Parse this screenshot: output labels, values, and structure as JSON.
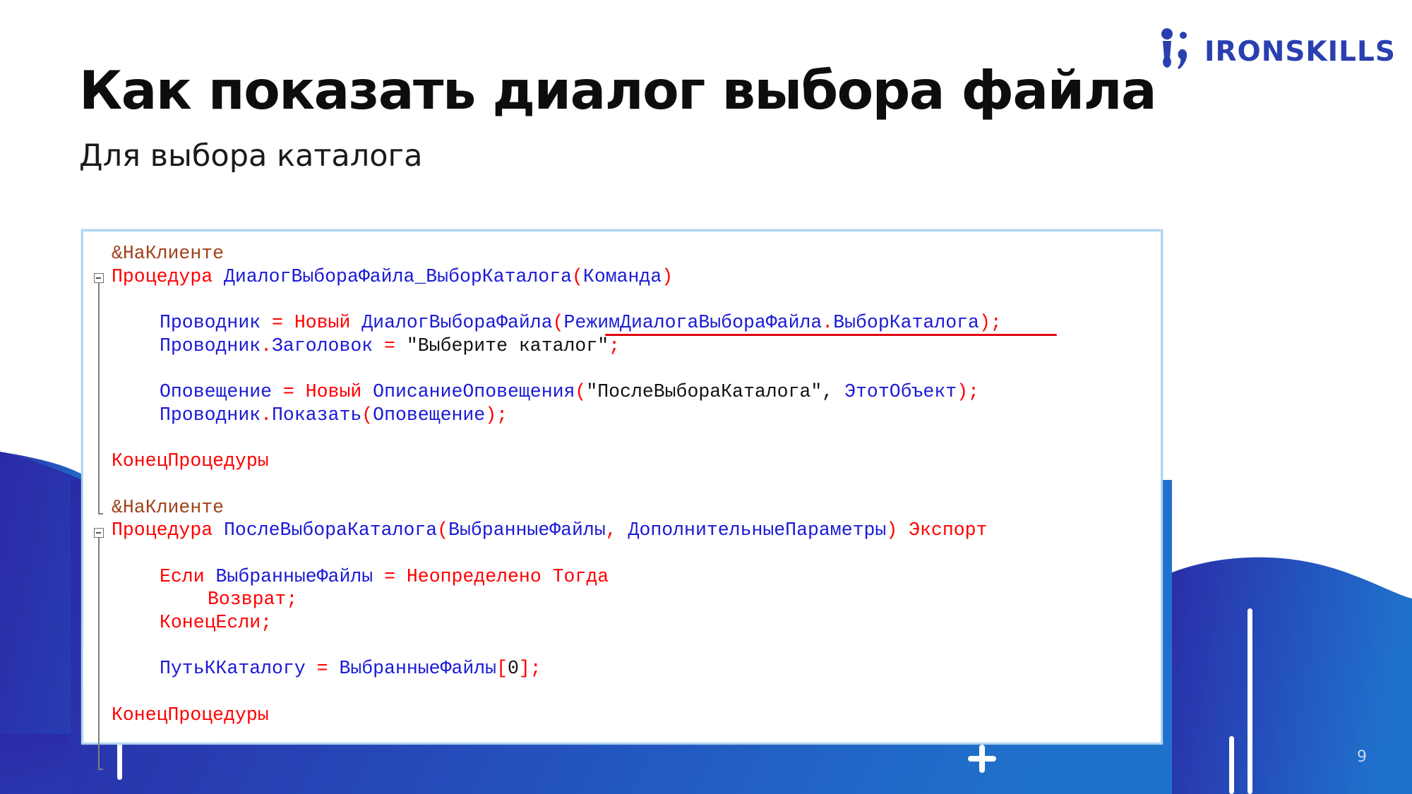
{
  "brand": {
    "name": "IRONSKILLS",
    "logo_icon": "ironskills-logo-icon",
    "color": "#2a3fb0"
  },
  "slide": {
    "title": "Как показать диалог выбора файла",
    "subtitle": "Для выбора каталога",
    "page_number": "9"
  },
  "colors": {
    "wave_gradient": [
      "#2b2aa6",
      "#1f6fc9"
    ],
    "keyword": "#ff0000",
    "identifier": "#1a1ad6",
    "directive": "#a0421a",
    "highlight_underline": "#e00010"
  },
  "code": {
    "language": "1C:Enterprise",
    "p1": {
      "directive": "&НаКлиенте",
      "kw_procedure": "Процедура",
      "name": "ДиалогВыбораФайла_ВыборКаталога",
      "lpar": "(",
      "param": "Команда",
      "rpar": ")",
      "l3_var": "Проводник",
      "l3_eq": " = ",
      "l3_new": "Новый",
      "l3_type": "ДиалогВыбораФайла",
      "l3_lpar": "(",
      "l3_mode_enum": "РежимДиалогаВыбораФайла",
      "l3_dot": ".",
      "l3_mode_value": "ВыборКаталога",
      "l3_end": ");",
      "l4_var": "Проводник",
      "l4_dot": ".",
      "l4_prop": "Заголовок",
      "l4_eq": " = ",
      "l4_str": "\"Выберите каталог\"",
      "l4_end": ";",
      "l6_var": "Оповещение",
      "l6_eq": " = ",
      "l6_new": "Новый",
      "l6_type": "ОписаниеОповещения",
      "l6_lpar": "(",
      "l6_str": "\"ПослеВыбораКаталога\"",
      "l6_comma": ", ",
      "l6_obj": "ЭтотОбъект",
      "l6_end": ");",
      "l7_var": "Проводник",
      "l7_dot": ".",
      "l7_method": "Показать",
      "l7_lpar": "(",
      "l7_arg": "Оповещение",
      "l7_end": ");",
      "end_procedure": "КонецПроцедуры"
    },
    "p2": {
      "directive": "&НаКлиенте",
      "kw_procedure": "Процедура",
      "name": "ПослеВыбораКаталога",
      "lpar": "(",
      "param1": "ВыбранныеФайлы",
      "comma": ", ",
      "param2": "ДополнительныеПараметры",
      "rpar": ")",
      "kw_export": "Экспорт",
      "l3_if": "Если",
      "l3_var": "ВыбранныеФайлы",
      "l3_eq": " = ",
      "l3_undef": "Неопределено",
      "l3_then": "Тогда",
      "l4_return": "Возврат",
      "l4_end": ";",
      "l5_endif": "КонецЕсли",
      "l5_end": ";",
      "l7_var": "ПутьККаталогу",
      "l7_eq": " = ",
      "l7_src": "ВыбранныеФайлы",
      "l7_lb": "[",
      "l7_idx": "0",
      "l7_end": "];",
      "end_procedure": "КонецПроцедуры"
    }
  }
}
